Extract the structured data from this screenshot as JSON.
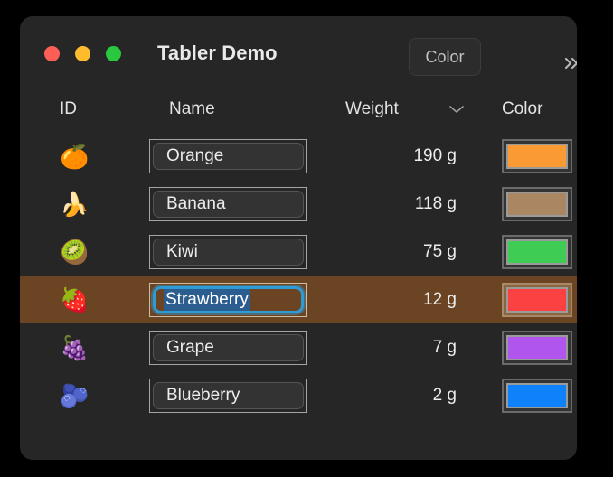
{
  "window": {
    "title": "Tabler Demo",
    "traffic_lights": [
      {
        "name": "close",
        "color": "#fd5f57"
      },
      {
        "name": "minimize",
        "color": "#fdbc2e"
      },
      {
        "name": "maximize",
        "color": "#29c83f"
      }
    ],
    "color_button_label": "Color",
    "overflow_icon": "chevron-double-right-icon",
    "background": "#262626"
  },
  "table": {
    "columns": [
      {
        "key": "id",
        "label": "ID"
      },
      {
        "key": "name",
        "label": "Name"
      },
      {
        "key": "weight",
        "label": "Weight",
        "sort_icon": "chevron-down-icon"
      },
      {
        "key": "color",
        "label": "Color"
      }
    ],
    "selected_row_index": 3,
    "selection_background": "#6b4423",
    "rows": [
      {
        "id_icon": "🍊",
        "id_name": "orange-emoji",
        "name": "Orange",
        "weight": "190 g",
        "color": "#f99b32"
      },
      {
        "id_icon": "🍌",
        "id_name": "banana-emoji",
        "name": "Banana",
        "weight": "118 g",
        "color": "#ab8663"
      },
      {
        "id_icon": "🥝",
        "id_name": "kiwi-emoji",
        "name": "Kiwi",
        "weight": "75 g",
        "color": "#3ecc54"
      },
      {
        "id_icon": "🍓",
        "id_name": "strawberry-emoji",
        "name": "Strawberry",
        "weight": "12 g",
        "color": "#fb4141"
      },
      {
        "id_icon": "🍇",
        "id_name": "grape-emoji",
        "name": "Grape",
        "weight": "7 g",
        "color": "#b055ee"
      },
      {
        "id_icon": "🫐",
        "id_name": "blueberry-emoji",
        "name": "Blueberry",
        "weight": "2 g",
        "color": "#0d82fb"
      }
    ]
  }
}
